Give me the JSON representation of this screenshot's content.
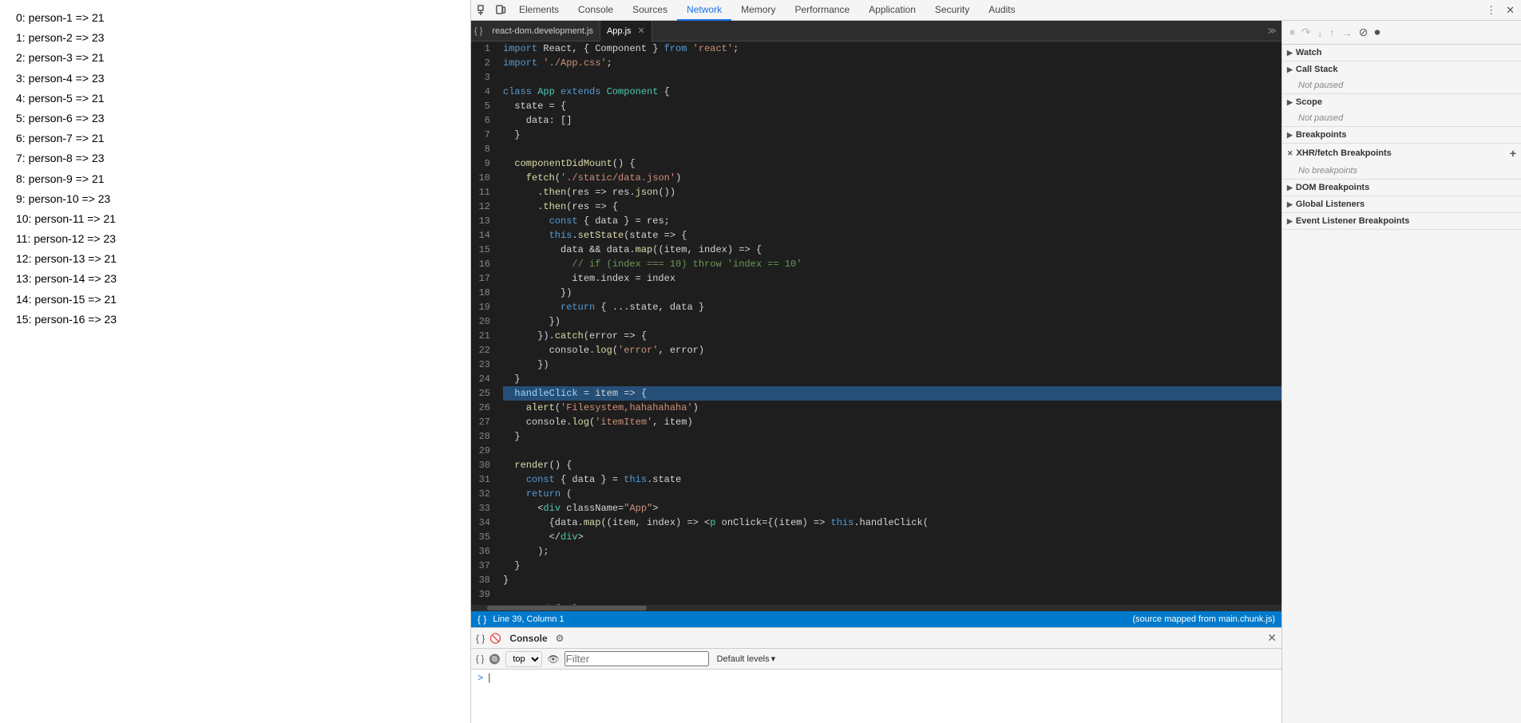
{
  "app": {
    "list_items": [
      "0: person-1 => 21",
      "1: person-2 => 23",
      "2: person-3 => 21",
      "3: person-4 => 23",
      "4: person-5 => 21",
      "5: person-6 => 23",
      "6: person-7 => 21",
      "7: person-8 => 23",
      "8: person-9 => 21",
      "9: person-10 => 23",
      "10: person-11 => 21",
      "11: person-12 => 23",
      "12: person-13 => 21",
      "13: person-14 => 23",
      "14: person-15 => 21",
      "15: person-16 => 23"
    ]
  },
  "devtools": {
    "tabs": [
      {
        "label": "Elements",
        "active": false
      },
      {
        "label": "Console",
        "active": false
      },
      {
        "label": "Sources",
        "active": false
      },
      {
        "label": "Network",
        "active": true
      },
      {
        "label": "Memory",
        "active": false
      },
      {
        "label": "Performance",
        "active": false
      },
      {
        "label": "Application",
        "active": false
      },
      {
        "label": "Security",
        "active": false
      },
      {
        "label": "Audits",
        "active": false
      }
    ]
  },
  "file_tabs": [
    {
      "label": "react-dom.development.js",
      "active": false
    },
    {
      "label": "App.js",
      "active": true,
      "closeable": true
    }
  ],
  "debugger": {
    "sections": [
      {
        "label": "Watch",
        "expanded": true,
        "content": null,
        "has_add": false
      },
      {
        "label": "Call Stack",
        "expanded": true,
        "content": "Not paused",
        "has_add": false
      },
      {
        "label": "Scope",
        "expanded": true,
        "content": "Not paused",
        "has_add": false
      },
      {
        "label": "Breakpoints",
        "expanded": true,
        "content": null,
        "has_add": false
      },
      {
        "label": "XHR/fetch Breakpoints",
        "expanded": true,
        "content": "No breakpoints",
        "has_add": true
      },
      {
        "label": "DOM Breakpoints",
        "expanded": true,
        "content": null,
        "has_add": false
      },
      {
        "label": "Global Listeners",
        "expanded": true,
        "content": null,
        "has_add": false
      },
      {
        "label": "Event Listener Breakpoints",
        "expanded": true,
        "content": null,
        "has_add": false
      }
    ]
  },
  "status_bar": {
    "position": "Line 39, Column 1",
    "source_map": "(source mapped from main.chunk.js)"
  },
  "console": {
    "label": "Console",
    "filter_placeholder": "Filter",
    "top_label": "top",
    "levels_label": "Default levels",
    "settings_icon": "⚙"
  },
  "code": {
    "highlighted_line": 25
  }
}
